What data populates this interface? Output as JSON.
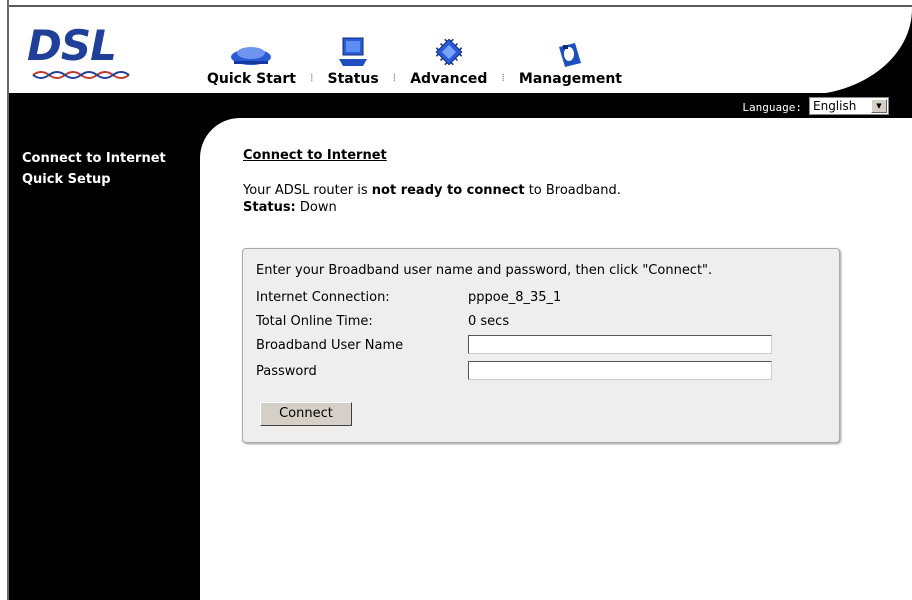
{
  "logo": {
    "text": "DSL"
  },
  "nav": {
    "items": [
      {
        "label": "Quick Start",
        "icon": "router-icon"
      },
      {
        "label": "Status",
        "icon": "monitor-icon"
      },
      {
        "label": "Advanced",
        "icon": "chip-icon"
      },
      {
        "label": "Management",
        "icon": "device-icon"
      }
    ]
  },
  "language": {
    "label": "Language:",
    "selected": "English"
  },
  "sidebar": {
    "items": [
      {
        "label": "Connect to Internet"
      },
      {
        "label": "Quick Setup"
      }
    ]
  },
  "main": {
    "title": "Connect to Internet",
    "status_prefix": "Your ADSL router is ",
    "status_bold": "not ready to connect",
    "status_suffix": " to Broadband.",
    "status_label": "Status:",
    "status_value": " Down"
  },
  "form": {
    "intro": "Enter your Broadband user name and password, then click \"Connect\".",
    "connection_label": "Internet Connection:",
    "connection_value": "pppoe_8_35_1",
    "online_label": "Total Online Time:",
    "online_value": "0 secs",
    "username_label": "Broadband User Name",
    "username_value": "",
    "password_label": "Password",
    "password_value": "",
    "connect_label": "Connect"
  },
  "colors": {
    "logo": "#1f3f98",
    "icon_blue": "#2a5bd7"
  }
}
